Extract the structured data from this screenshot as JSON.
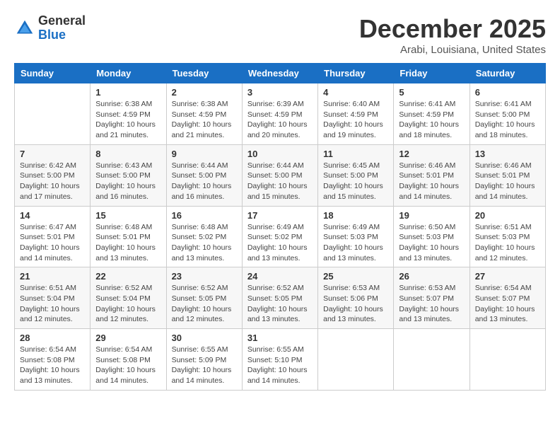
{
  "logo": {
    "general": "General",
    "blue": "Blue"
  },
  "title": "December 2025",
  "subtitle": "Arabi, Louisiana, United States",
  "days_of_week": [
    "Sunday",
    "Monday",
    "Tuesday",
    "Wednesday",
    "Thursday",
    "Friday",
    "Saturday"
  ],
  "weeks": [
    [
      {
        "day": "",
        "info": ""
      },
      {
        "day": "1",
        "info": "Sunrise: 6:38 AM\nSunset: 4:59 PM\nDaylight: 10 hours\nand 21 minutes."
      },
      {
        "day": "2",
        "info": "Sunrise: 6:38 AM\nSunset: 4:59 PM\nDaylight: 10 hours\nand 21 minutes."
      },
      {
        "day": "3",
        "info": "Sunrise: 6:39 AM\nSunset: 4:59 PM\nDaylight: 10 hours\nand 20 minutes."
      },
      {
        "day": "4",
        "info": "Sunrise: 6:40 AM\nSunset: 4:59 PM\nDaylight: 10 hours\nand 19 minutes."
      },
      {
        "day": "5",
        "info": "Sunrise: 6:41 AM\nSunset: 4:59 PM\nDaylight: 10 hours\nand 18 minutes."
      },
      {
        "day": "6",
        "info": "Sunrise: 6:41 AM\nSunset: 5:00 PM\nDaylight: 10 hours\nand 18 minutes."
      }
    ],
    [
      {
        "day": "7",
        "info": "Sunrise: 6:42 AM\nSunset: 5:00 PM\nDaylight: 10 hours\nand 17 minutes."
      },
      {
        "day": "8",
        "info": "Sunrise: 6:43 AM\nSunset: 5:00 PM\nDaylight: 10 hours\nand 16 minutes."
      },
      {
        "day": "9",
        "info": "Sunrise: 6:44 AM\nSunset: 5:00 PM\nDaylight: 10 hours\nand 16 minutes."
      },
      {
        "day": "10",
        "info": "Sunrise: 6:44 AM\nSunset: 5:00 PM\nDaylight: 10 hours\nand 15 minutes."
      },
      {
        "day": "11",
        "info": "Sunrise: 6:45 AM\nSunset: 5:00 PM\nDaylight: 10 hours\nand 15 minutes."
      },
      {
        "day": "12",
        "info": "Sunrise: 6:46 AM\nSunset: 5:01 PM\nDaylight: 10 hours\nand 14 minutes."
      },
      {
        "day": "13",
        "info": "Sunrise: 6:46 AM\nSunset: 5:01 PM\nDaylight: 10 hours\nand 14 minutes."
      }
    ],
    [
      {
        "day": "14",
        "info": "Sunrise: 6:47 AM\nSunset: 5:01 PM\nDaylight: 10 hours\nand 14 minutes."
      },
      {
        "day": "15",
        "info": "Sunrise: 6:48 AM\nSunset: 5:01 PM\nDaylight: 10 hours\nand 13 minutes."
      },
      {
        "day": "16",
        "info": "Sunrise: 6:48 AM\nSunset: 5:02 PM\nDaylight: 10 hours\nand 13 minutes."
      },
      {
        "day": "17",
        "info": "Sunrise: 6:49 AM\nSunset: 5:02 PM\nDaylight: 10 hours\nand 13 minutes."
      },
      {
        "day": "18",
        "info": "Sunrise: 6:49 AM\nSunset: 5:03 PM\nDaylight: 10 hours\nand 13 minutes."
      },
      {
        "day": "19",
        "info": "Sunrise: 6:50 AM\nSunset: 5:03 PM\nDaylight: 10 hours\nand 13 minutes."
      },
      {
        "day": "20",
        "info": "Sunrise: 6:51 AM\nSunset: 5:03 PM\nDaylight: 10 hours\nand 12 minutes."
      }
    ],
    [
      {
        "day": "21",
        "info": "Sunrise: 6:51 AM\nSunset: 5:04 PM\nDaylight: 10 hours\nand 12 minutes."
      },
      {
        "day": "22",
        "info": "Sunrise: 6:52 AM\nSunset: 5:04 PM\nDaylight: 10 hours\nand 12 minutes."
      },
      {
        "day": "23",
        "info": "Sunrise: 6:52 AM\nSunset: 5:05 PM\nDaylight: 10 hours\nand 12 minutes."
      },
      {
        "day": "24",
        "info": "Sunrise: 6:52 AM\nSunset: 5:05 PM\nDaylight: 10 hours\nand 13 minutes."
      },
      {
        "day": "25",
        "info": "Sunrise: 6:53 AM\nSunset: 5:06 PM\nDaylight: 10 hours\nand 13 minutes."
      },
      {
        "day": "26",
        "info": "Sunrise: 6:53 AM\nSunset: 5:07 PM\nDaylight: 10 hours\nand 13 minutes."
      },
      {
        "day": "27",
        "info": "Sunrise: 6:54 AM\nSunset: 5:07 PM\nDaylight: 10 hours\nand 13 minutes."
      }
    ],
    [
      {
        "day": "28",
        "info": "Sunrise: 6:54 AM\nSunset: 5:08 PM\nDaylight: 10 hours\nand 13 minutes."
      },
      {
        "day": "29",
        "info": "Sunrise: 6:54 AM\nSunset: 5:08 PM\nDaylight: 10 hours\nand 14 minutes."
      },
      {
        "day": "30",
        "info": "Sunrise: 6:55 AM\nSunset: 5:09 PM\nDaylight: 10 hours\nand 14 minutes."
      },
      {
        "day": "31",
        "info": "Sunrise: 6:55 AM\nSunset: 5:10 PM\nDaylight: 10 hours\nand 14 minutes."
      },
      {
        "day": "",
        "info": ""
      },
      {
        "day": "",
        "info": ""
      },
      {
        "day": "",
        "info": ""
      }
    ]
  ]
}
